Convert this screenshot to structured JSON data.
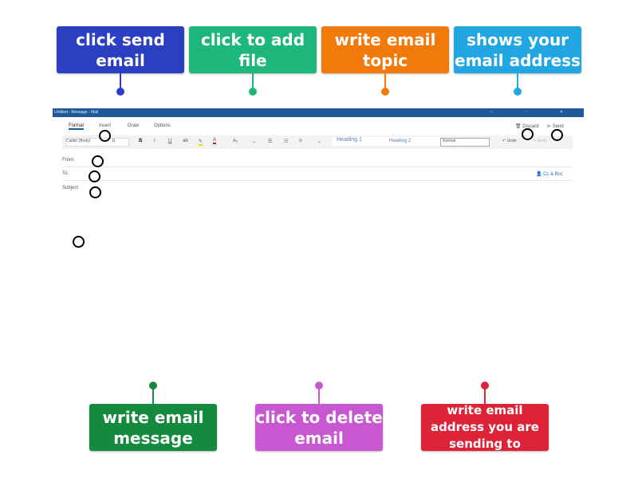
{
  "labels_top": [
    {
      "text": "click send email",
      "color": "#2a3fc2"
    },
    {
      "text": "click to add file",
      "color": "#1db77c"
    },
    {
      "text": "write email topic",
      "color": "#f27a0b"
    },
    {
      "text": "shows your email address",
      "color": "#22a6e2"
    }
  ],
  "labels_bottom": [
    {
      "text": "write email message",
      "color": "#138a3e"
    },
    {
      "text": "click to delete email",
      "color": "#c758d2"
    },
    {
      "text": "write email address you are sending to",
      "color": "#dd2337"
    }
  ],
  "window": {
    "title": "Untitled - Message - Mail",
    "controls": "– ▫ ✕",
    "tabs": [
      "Format",
      "Insert",
      "Draw",
      "Options"
    ],
    "font": "Calibri (Body)",
    "size": "11",
    "format_buttons": [
      "B",
      "I",
      "U",
      "ab",
      "✎",
      "A",
      "A₂",
      "⌄",
      "☰",
      "☷",
      "≡",
      "⌄"
    ],
    "styles": [
      "Heading 1",
      "Heading 2"
    ],
    "style_select": "Normal",
    "undo": "Undo",
    "redo": "Redo",
    "discard": "Discard",
    "send": "Send",
    "from": "From:",
    "to": "To:",
    "subject": "Subject",
    "cc_bcc": "Cc & Bcc"
  }
}
